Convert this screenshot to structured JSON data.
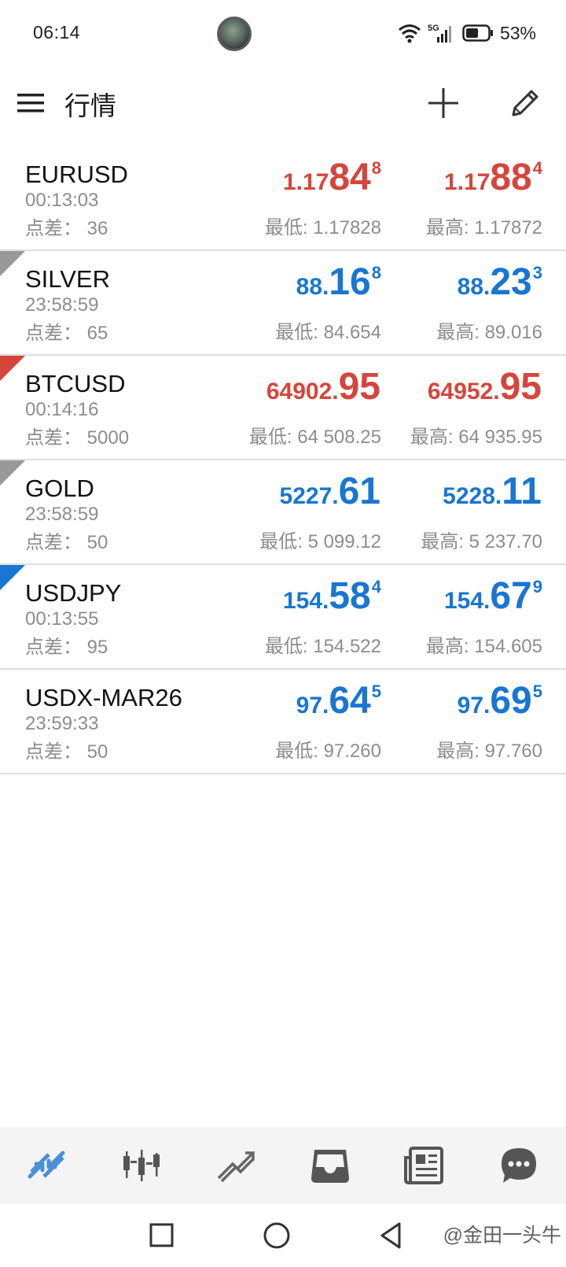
{
  "status_bar": {
    "time": "06:14",
    "network": "5G",
    "battery": "53%"
  },
  "toolbar": {
    "title": "行情"
  },
  "colors": {
    "up": "#d6453c",
    "down": "#1976d2",
    "grey_marker": "#999999",
    "nav_active": "#4a90d9"
  },
  "quotes": [
    {
      "symbol": "EURUSD",
      "time": "00:13:03",
      "spread_label": "点差：",
      "spread": "36",
      "direction": "up",
      "marker": "none",
      "bid": {
        "small": "1.17",
        "big": "84",
        "sup": "8"
      },
      "ask": {
        "small": "1.17",
        "big": "88",
        "sup": "4"
      },
      "low": "最低: 1.17828",
      "high": "最高: 1.17872"
    },
    {
      "symbol": "SILVER",
      "time": "23:58:59",
      "spread_label": "点差：",
      "spread": "65",
      "direction": "down",
      "marker": "grey",
      "bid": {
        "small": "88.",
        "big": "16",
        "sup": "8"
      },
      "ask": {
        "small": "88.",
        "big": "23",
        "sup": "3"
      },
      "low": "最低: 84.654",
      "high": "最高: 89.016"
    },
    {
      "symbol": "BTCUSD",
      "time": "00:14:16",
      "spread_label": "点差：",
      "spread": "5000",
      "direction": "up",
      "marker": "red",
      "bid": {
        "small": "64902.",
        "big": "95",
        "sup": ""
      },
      "ask": {
        "small": "64952.",
        "big": "95",
        "sup": ""
      },
      "low": "最低: 64 508.25",
      "high": "最高: 64 935.95"
    },
    {
      "symbol": "GOLD",
      "time": "23:58:59",
      "spread_label": "点差：",
      "spread": "50",
      "direction": "down",
      "marker": "grey",
      "bid": {
        "small": "5227.",
        "big": "61",
        "sup": ""
      },
      "ask": {
        "small": "5228.",
        "big": "11",
        "sup": ""
      },
      "low": "最低: 5 099.12",
      "high": "最高: 5 237.70"
    },
    {
      "symbol": "USDJPY",
      "time": "00:13:55",
      "spread_label": "点差：",
      "spread": "95",
      "direction": "down",
      "marker": "blue",
      "bid": {
        "small": "154.",
        "big": "58",
        "sup": "4"
      },
      "ask": {
        "small": "154.",
        "big": "67",
        "sup": "9"
      },
      "low": "最低: 154.522",
      "high": "最高: 154.605"
    },
    {
      "symbol": "USDX-MAR26",
      "time": "23:59:33",
      "spread_label": "点差：",
      "spread": "50",
      "direction": "down",
      "marker": "none",
      "bid": {
        "small": "97.",
        "big": "64",
        "sup": "5"
      },
      "ask": {
        "small": "97.",
        "big": "69",
        "sup": "5"
      },
      "low": "最低: 97.260",
      "high": "最高: 97.760"
    }
  ],
  "bottom_nav": [
    {
      "icon": "quotes-arrows-icon",
      "active": true
    },
    {
      "icon": "candlestick-chart-icon",
      "active": false
    },
    {
      "icon": "trade-trend-icon",
      "active": false
    },
    {
      "icon": "inbox-tray-icon",
      "active": false
    },
    {
      "icon": "news-icon",
      "active": false
    },
    {
      "icon": "chat-bubble-icon",
      "active": false
    }
  ],
  "watermark": "@金田一头牛"
}
